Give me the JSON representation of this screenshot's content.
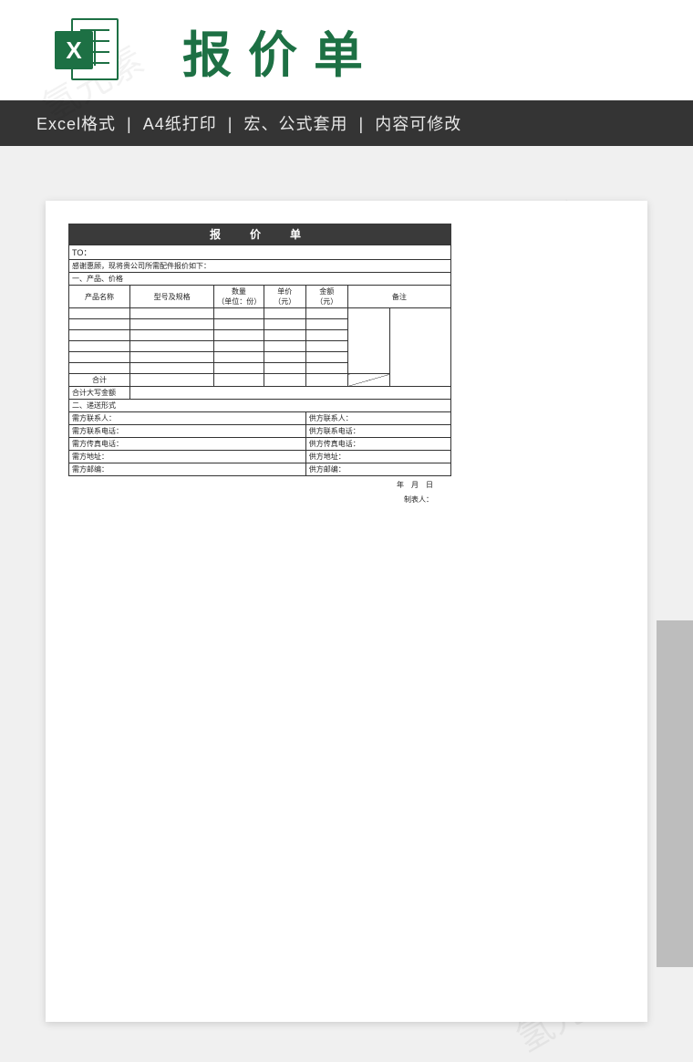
{
  "watermark_text": "氢元素",
  "header": {
    "icon_letter": "X",
    "title": "报价单"
  },
  "features": {
    "f1": "Excel格式",
    "f2": "A4纸打印",
    "f3": "宏、公式套用",
    "f4": "内容可修改",
    "sep": "|"
  },
  "doc": {
    "title": "报　价　单",
    "to_label": "TO：",
    "intro": "感谢惠顾，现将贵公司所需配件报价如下：",
    "section1": "一、产品、价格",
    "columns": {
      "c1": "产品名称",
      "c2": "型号及规格",
      "c3": "数量\n（单位：份）",
      "c4": "单价\n（元）",
      "c5": "金额\n（元）",
      "c6": "备注"
    },
    "rows_count": 6,
    "subtotal": "合计",
    "total_cn": "合计大写金额",
    "section2": "二、递送形式",
    "contacts": [
      {
        "left": "需方联系人：",
        "right": "供方联系人："
      },
      {
        "left": "需方联系电话：",
        "right": "供方联系电话："
      },
      {
        "left": "需方传真电话：",
        "right": "供方传真电话："
      },
      {
        "left": "需方地址：",
        "right": "供方地址："
      },
      {
        "left": "需方邮编：",
        "right": "供方邮编："
      }
    ],
    "footer_date": "年　月　日",
    "footer_sign": "制表人："
  }
}
